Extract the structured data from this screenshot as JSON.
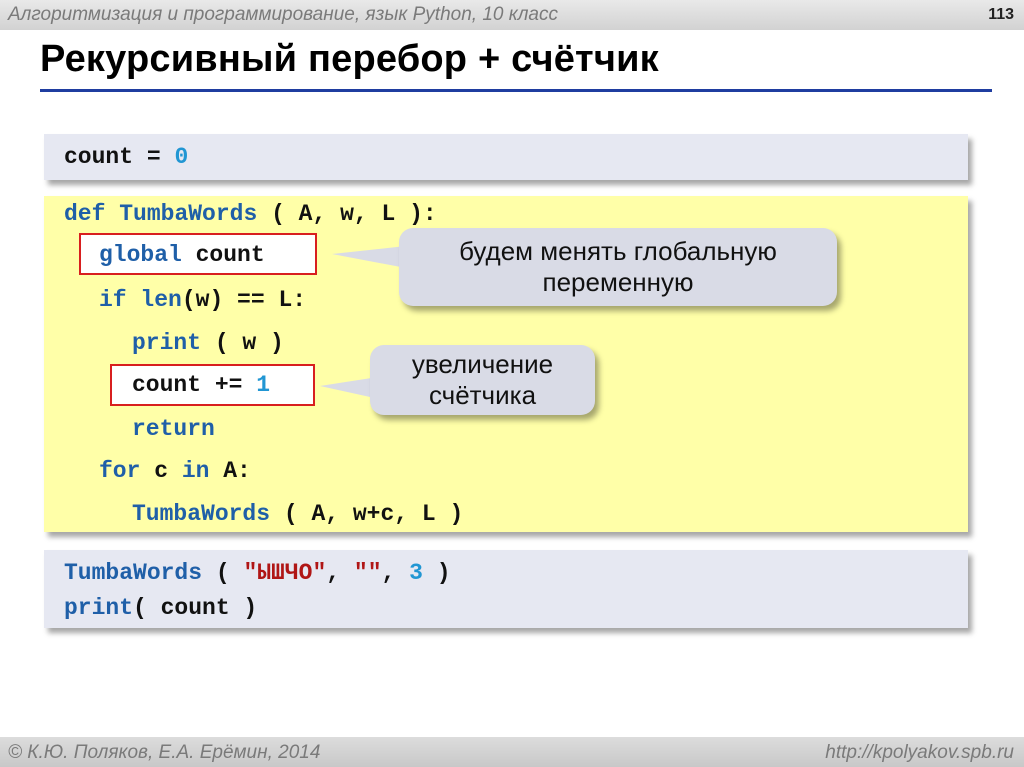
{
  "header": {
    "course": "Алгоритмизация и программирование, язык Python, 10 класс",
    "page_number": "113"
  },
  "title": "Рекурсивный перебор + счётчик",
  "code_init": {
    "var": "count",
    "op": " = ",
    "val": "0"
  },
  "code_func": {
    "line1": {
      "kw": "def",
      "name": "TumbaWords",
      "params": " ( A, w, L ):"
    },
    "line2": {
      "kw": "global",
      "rest": " count"
    },
    "line3": {
      "kw": "if",
      "fn": "len",
      "rest": "(w) == L:"
    },
    "line4": {
      "fn": "print",
      "rest": " ( w )"
    },
    "line5": {
      "var": "count",
      "op": " += ",
      "val": "1"
    },
    "line6": {
      "kw": "return"
    },
    "line7": {
      "kw": "for",
      "mid": " c ",
      "kw2": "in",
      "rest": " A:"
    },
    "line8": {
      "fn": "TumbaWords",
      "rest": " ( A, w+c, L )"
    }
  },
  "code_call": {
    "line1": {
      "fn": "TumbaWords",
      "open": " ( ",
      "str1": "\"ЫШЧО\"",
      "sep1": ", ",
      "str2": "\"\"",
      "sep2": ", ",
      "num": "3",
      "close": " )"
    },
    "line2": {
      "fn": "print",
      "rest": "( count )"
    }
  },
  "callouts": {
    "global_note": {
      "line1": "будем менять глобальную",
      "line2": "переменную"
    },
    "counter_note": {
      "line1": "увеличение",
      "line2": "счётчика"
    }
  },
  "footer": {
    "authors": "© К.Ю. Поляков, Е.А. Ерёмин, 2014",
    "url": "http://kpolyakov.spb.ru"
  }
}
